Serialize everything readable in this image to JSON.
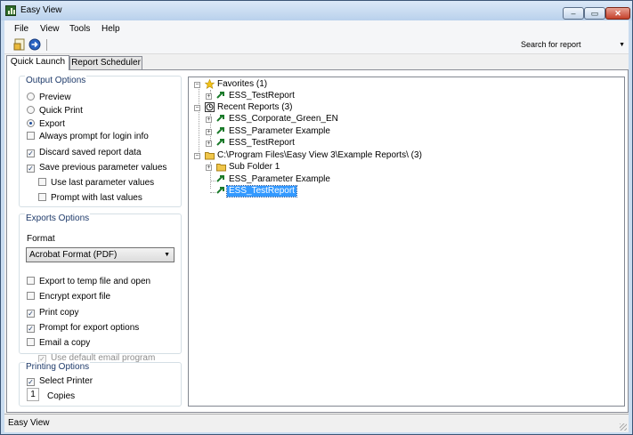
{
  "window": {
    "title": "Easy View",
    "min_label": "–",
    "max_label": "▭",
    "close_label": "✕"
  },
  "menu": {
    "items": [
      "File",
      "View",
      "Tools",
      "Help"
    ]
  },
  "toolbar": {
    "search_placeholder": "Search for report",
    "dropdown_glyph": "▼"
  },
  "tabs": [
    {
      "label": "Quick Launch",
      "active": true
    },
    {
      "label": "Report Scheduler",
      "active": false
    }
  ],
  "output_options": {
    "title": "Output Options",
    "radios": [
      {
        "label": "Preview",
        "selected": false
      },
      {
        "label": "Quick Print",
        "selected": false
      },
      {
        "label": "Export",
        "selected": true
      }
    ],
    "checks": [
      {
        "label": "Always prompt for login info",
        "checked": false
      },
      {
        "label": "Discard saved report data",
        "checked": true
      },
      {
        "label": "Save previous parameter values",
        "checked": true
      },
      {
        "label": "Use last parameter values",
        "checked": false
      },
      {
        "label": "Prompt with last values",
        "checked": false
      }
    ]
  },
  "exports_options": {
    "title": "Exports Options",
    "format_label": "Format",
    "format_value": "Acrobat Format (PDF)",
    "checks": [
      {
        "label": "Export to temp file and open",
        "checked": false
      },
      {
        "label": "Encrypt export file",
        "checked": false
      },
      {
        "label": "Print copy",
        "checked": true
      },
      {
        "label": "Prompt for export options",
        "checked": true
      },
      {
        "label": "Email a copy",
        "checked": false
      },
      {
        "label": "Use default email program",
        "checked": true,
        "disabled": true
      }
    ]
  },
  "printing_options": {
    "title": "Printing Options",
    "select_printer": {
      "label": "Select Printer",
      "checked": true
    },
    "copies_value": "1",
    "copies_label": "Copies"
  },
  "tree": {
    "favorites": {
      "label": "Favorites (1)",
      "children": [
        "ESS_TestReport"
      ]
    },
    "recent": {
      "label": "Recent Reports (3)",
      "children": [
        "ESS_Corporate_Green_EN",
        "ESS_Parameter Example",
        "ESS_TestReport"
      ]
    },
    "folder": {
      "label": "C:\\Program Files\\Easy View 3\\Example Reports\\ (3)",
      "subfolder": "Sub Folder 1",
      "children": [
        "ESS_Parameter Example",
        "ESS_TestReport"
      ]
    },
    "selected": "ESS_TestReport"
  },
  "statusbar": {
    "text": "Easy View"
  },
  "colors": {
    "selection": "#3399ff",
    "titlebar": "#c9dcf0",
    "report_arrow": "#1a7a2a",
    "folder": "#f0c64a"
  }
}
